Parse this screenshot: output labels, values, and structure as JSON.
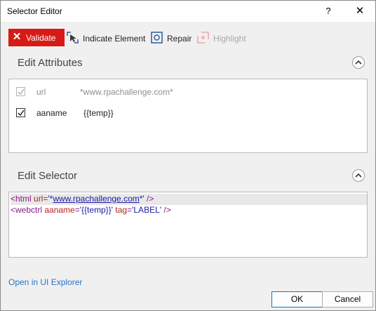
{
  "window": {
    "title": "Selector Editor",
    "help_label": "?",
    "close_label": "✕"
  },
  "toolbar": {
    "validate_label": "Validate",
    "indicate_label": "Indicate Element",
    "repair_label": "Repair",
    "highlight_label": "Highlight",
    "validate_color": "#d81a16"
  },
  "edit_attributes": {
    "title": "Edit Attributes",
    "rows": [
      {
        "name": "url",
        "value": "*www.rpachallenge.com*",
        "checked": true,
        "enabled": false
      },
      {
        "name": "aaname",
        "value": "{{temp}}",
        "checked": true,
        "enabled": true
      }
    ]
  },
  "edit_selector": {
    "title": "Edit Selector",
    "line1": {
      "open": "<html ",
      "attr": "url",
      "eq": "=",
      "q1": "'*",
      "link": "www.rpachallenge.com",
      "q2": "*'",
      "close": " />"
    },
    "line2": {
      "open": "<webctrl ",
      "attr1": "aaname",
      "eq1": "=",
      "val1": "'{{temp}}'",
      "space": " ",
      "attr2": "tag",
      "eq2": "=",
      "val2": "'LABEL'",
      "close": " />"
    }
  },
  "footer": {
    "open_ui_explorer": "Open in UI Explorer",
    "ok_label": "OK",
    "cancel_label": "Cancel"
  }
}
